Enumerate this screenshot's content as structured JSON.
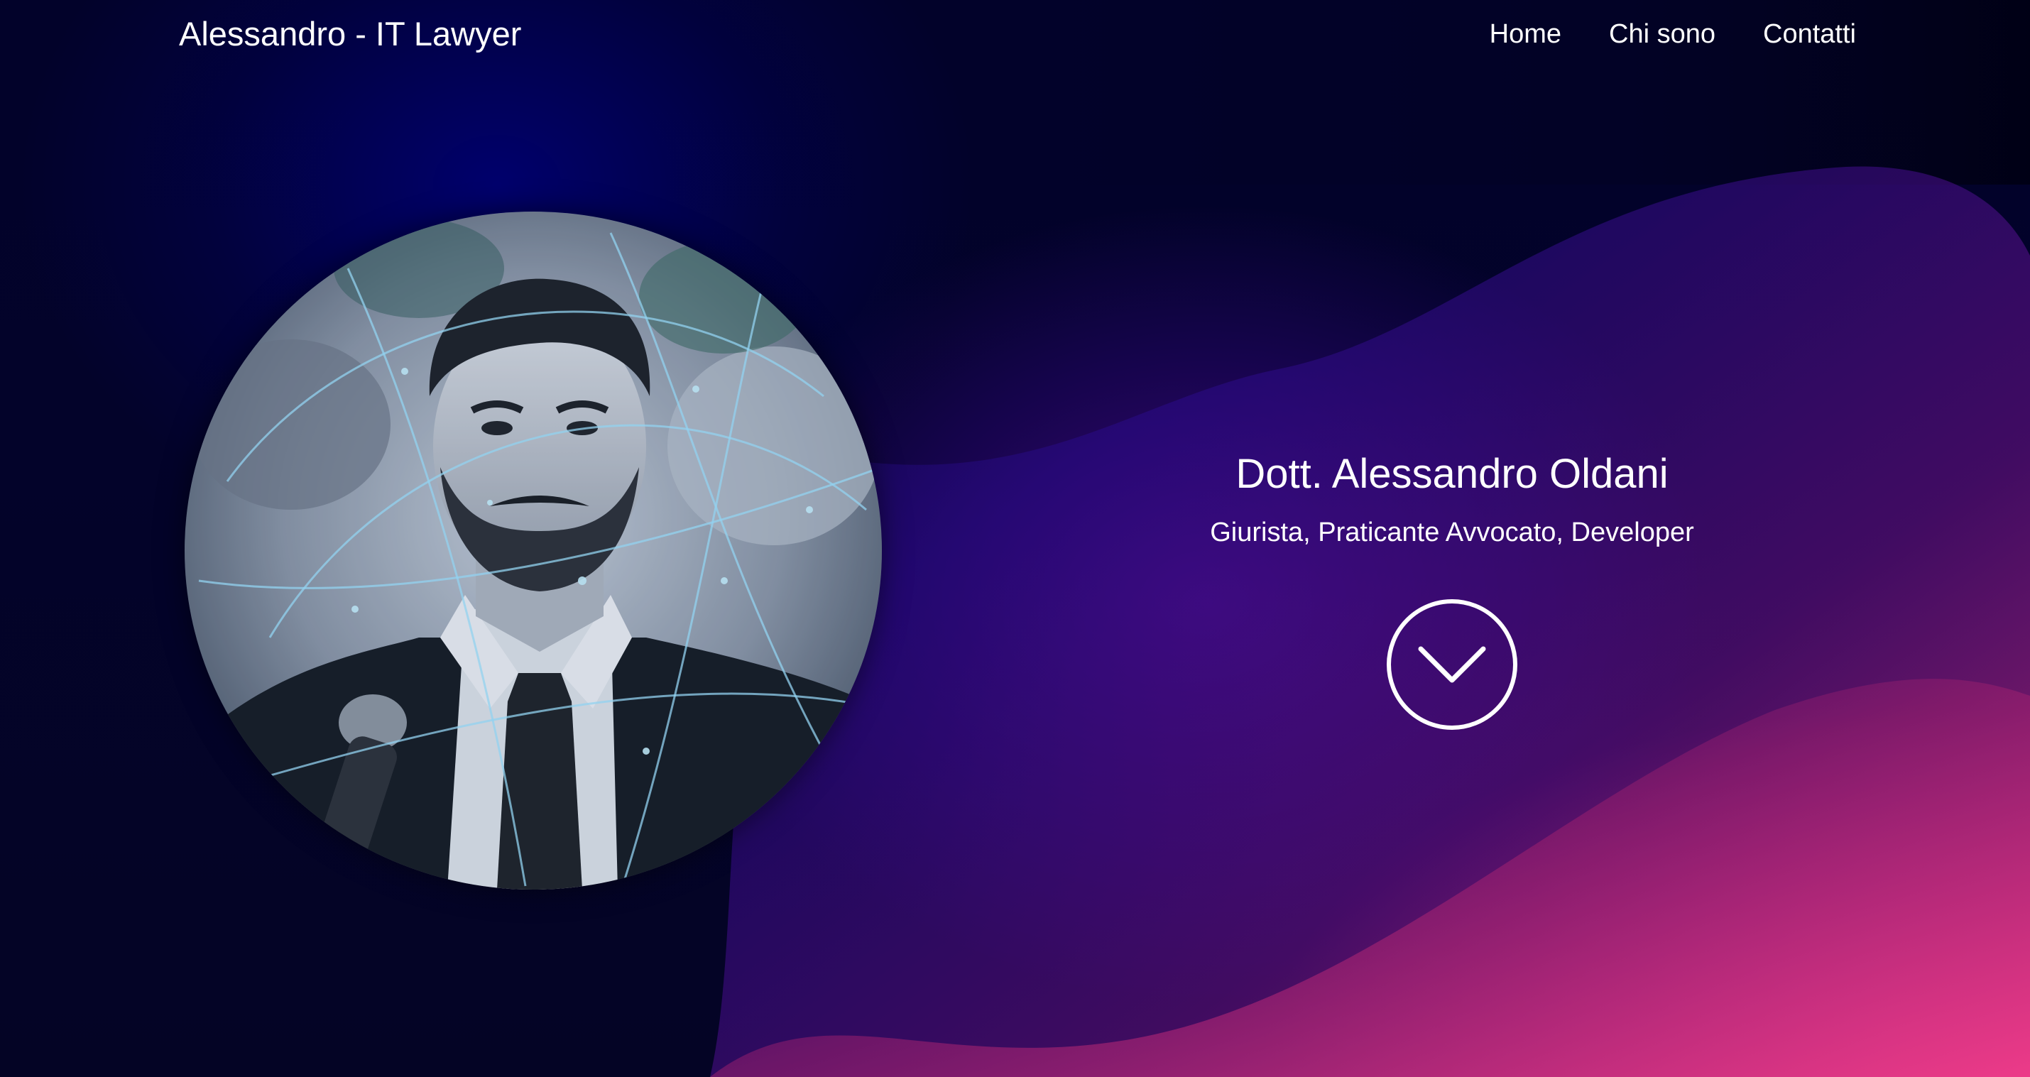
{
  "navbar": {
    "brand": "Alessandro - IT Lawyer",
    "links": [
      {
        "label": "Home"
      },
      {
        "label": "Chi sono"
      },
      {
        "label": "Contatti"
      }
    ]
  },
  "hero": {
    "title": "Dott. Alessandro Oldani",
    "subtitle": "Giurista, Praticante Avvocato, Developer",
    "scroll_icon": "chevron-down-icon"
  },
  "colors": {
    "background_dark": "#03032a",
    "background_blue": "#000078",
    "background_purple": "#460a82",
    "background_pink": "#eb378c",
    "text": "#ffffff"
  }
}
